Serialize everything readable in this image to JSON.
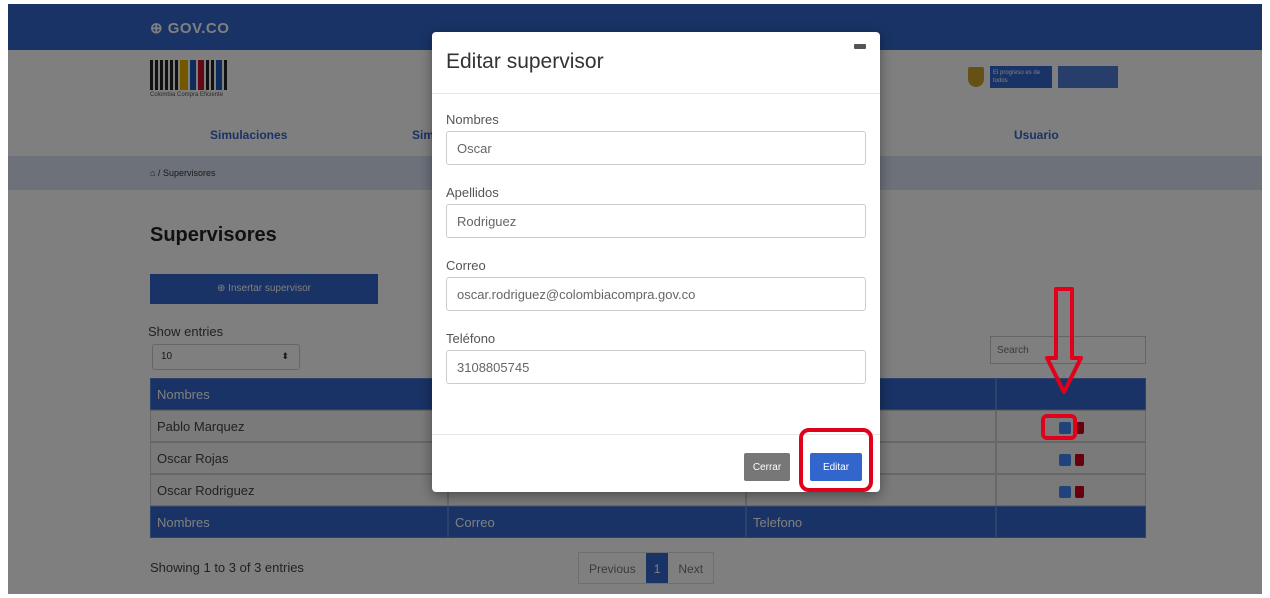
{
  "header": {
    "gov_logo": "⊕ GOV.CO",
    "cce_caption": "Colombia Compra Eficiente",
    "gov_badge": "El progreso es de todos"
  },
  "nav": {
    "items": [
      "Simulaciones",
      "Sim",
      "Usuario"
    ]
  },
  "breadcrumb": "⌂ / Supervisores",
  "page": {
    "title": "Supervisores",
    "insert_button": "⊕ Insertar supervisor",
    "show_entries_label": "Show entries",
    "entries_value": "10",
    "search_placeholder": "Search"
  },
  "table": {
    "headers": [
      "Nombres",
      "Correo",
      "Telefono"
    ],
    "rows": [
      {
        "nombres": "Pablo Marquez"
      },
      {
        "nombres": "Oscar Rojas"
      },
      {
        "nombres": "Oscar Rodriguez"
      }
    ]
  },
  "pagination": {
    "showing": "Showing 1 to 3 of 3 entries",
    "previous": "Previous",
    "current": "1",
    "next": "Next"
  },
  "modal": {
    "title": "Editar supervisor",
    "fields": [
      {
        "label": "Nombres",
        "value": "Oscar"
      },
      {
        "label": "Apellidos",
        "value": "Rodriguez"
      },
      {
        "label": "Correo",
        "value": "oscar.rodriguez@colombiacompra.gov.co"
      },
      {
        "label": "Teléfono",
        "value": "3108805745"
      }
    ],
    "close_button": "Cerrar",
    "edit_button": "Editar"
  },
  "colors": {
    "primary": "#3366cc",
    "annotation": "#e0001b",
    "delete": "#d0021b"
  }
}
